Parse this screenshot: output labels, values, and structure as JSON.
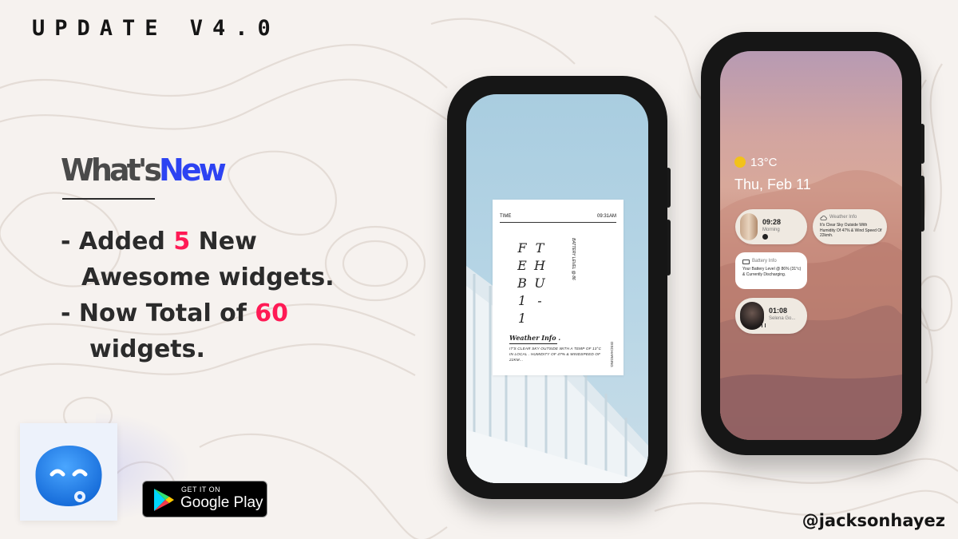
{
  "header": {
    "title": "UPDATE V4.0"
  },
  "whats_new": {
    "word1": "What's",
    "word2": "New",
    "colors": {
      "accent_blue": "#2d43f2",
      "accent_pink": "#ff1a55"
    }
  },
  "changes": {
    "line1_prefix": "- Added ",
    "line1_number": "5",
    "line1_suffix": " New",
    "line2": "Awesome widgets.",
    "line3_prefix": "- Now Total of ",
    "line3_number": "60",
    "line4": "widgets."
  },
  "store_badge": {
    "small": "GET IT ON",
    "big": "Google Play"
  },
  "handle": "@jacksonhayez",
  "phone1_widget": {
    "time_label": "TIME",
    "time_value": "09:31AM",
    "battery": "BATTERY LEVEL @ 86",
    "col1": [
      "F",
      "E",
      "B",
      "1",
      "1"
    ],
    "col2": [
      "T",
      "H",
      "U",
      "-"
    ],
    "weather_title": "Weather Info .",
    "weather_desc": "IT'S CLEAR SKY OUTSIDE WITH A TEMP OF 13°C IN LOCAL . HUMIDITY OF 47% & WINDSPEED OF 22KM...",
    "side_text": "DISCHARGING"
  },
  "phone2": {
    "temp": "13°C",
    "date": "Thu, Feb 11",
    "clock": {
      "time": "09:28",
      "label": "Morning"
    },
    "weather": {
      "title": "Weather Info",
      "desc": "It's Clear Sky Outside With Humidity Of 47% & Wind Speed Of 22kmh."
    },
    "battery": {
      "title": "Battery Info",
      "desc": "Your Battery Level @ 86% (31°c) & Currently Discharging."
    },
    "music": {
      "time": "01:08",
      "artist": "Selena Go..."
    }
  },
  "icons": [
    "app-icon",
    "google-play-icon",
    "sun-icon",
    "cloud-icon",
    "battery-icon",
    "pause-icon",
    "user-icon"
  ]
}
